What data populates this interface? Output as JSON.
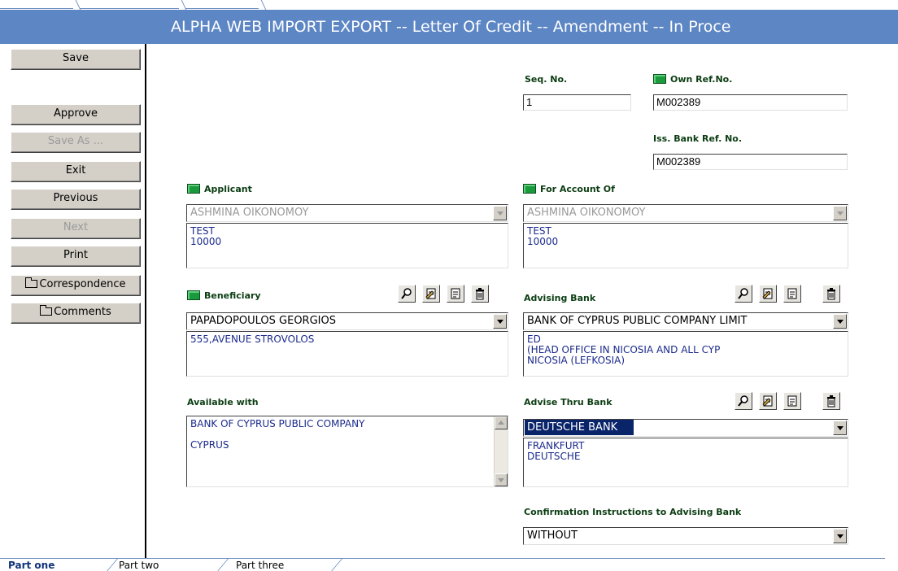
{
  "window": {
    "title": "ALPHA WEB IMPORT EXPORT --   Letter Of Credit -- Amendment -- In Proce"
  },
  "sidebar": {
    "save": "Save",
    "approve": "Approve",
    "save_as": "Save As ...",
    "exit": "Exit",
    "previous": "Previous",
    "next": "Next",
    "print": "Print",
    "correspondence": "Correspondence",
    "comments": "Comments"
  },
  "form": {
    "seq_no": {
      "label": "Seq. No.",
      "value": "1"
    },
    "own_ref_no": {
      "label": "Own Ref.No.",
      "value": "M002389"
    },
    "iss_bank_ref_no": {
      "label": "Iss. Bank Ref. No.",
      "value": "M002389"
    },
    "applicant": {
      "label": "Applicant",
      "selected": "ASHMINA OIKONOMOY",
      "address": [
        "TEST",
        "10000"
      ]
    },
    "for_account_of": {
      "label": "For Account Of",
      "selected": "ASHMINA OIKONOMOY",
      "address": [
        "TEST",
        "10000"
      ]
    },
    "beneficiary": {
      "label": "Beneficiary",
      "selected": "PAPADOPOULOS GEORGIOS",
      "address": [
        "555,AVENUE STROVOLOS"
      ]
    },
    "advising_bank": {
      "label": "Advising Bank",
      "selected": "BANK OF CYPRUS PUBLIC COMPANY LIMIT",
      "address": [
        "ED",
        "(HEAD OFFICE IN NICOSIA AND ALL CYP",
        "NICOSIA (LEFKOSIA)"
      ]
    },
    "available_with": {
      "label": "Available with",
      "lines": [
        "BANK OF CYPRUS PUBLIC COMPANY",
        "",
        "CYPRUS"
      ]
    },
    "advise_thru_bank": {
      "label": "Advise Thru Bank",
      "selected": "DEUTSCHE BANK",
      "address": [
        "FRANKFURT",
        "DEUTSCHE"
      ]
    },
    "confirmation_instructions": {
      "label": "Confirmation Instructions to Advising Bank",
      "selected": "WITHOUT"
    }
  },
  "tabs": [
    "Part one",
    "Part two",
    "Part three"
  ],
  "colors": {
    "title_bar": "#5d86c5",
    "label_text": "#0b3d12",
    "flag": "#1a9a3c",
    "address_text": "#1b2a8c",
    "selection": "#0a246a"
  },
  "icons": [
    "search-icon",
    "edit-document-icon",
    "document-icon",
    "trash-icon",
    "folder-icon",
    "flag-icon",
    "dropdown-arrow-icon"
  ]
}
